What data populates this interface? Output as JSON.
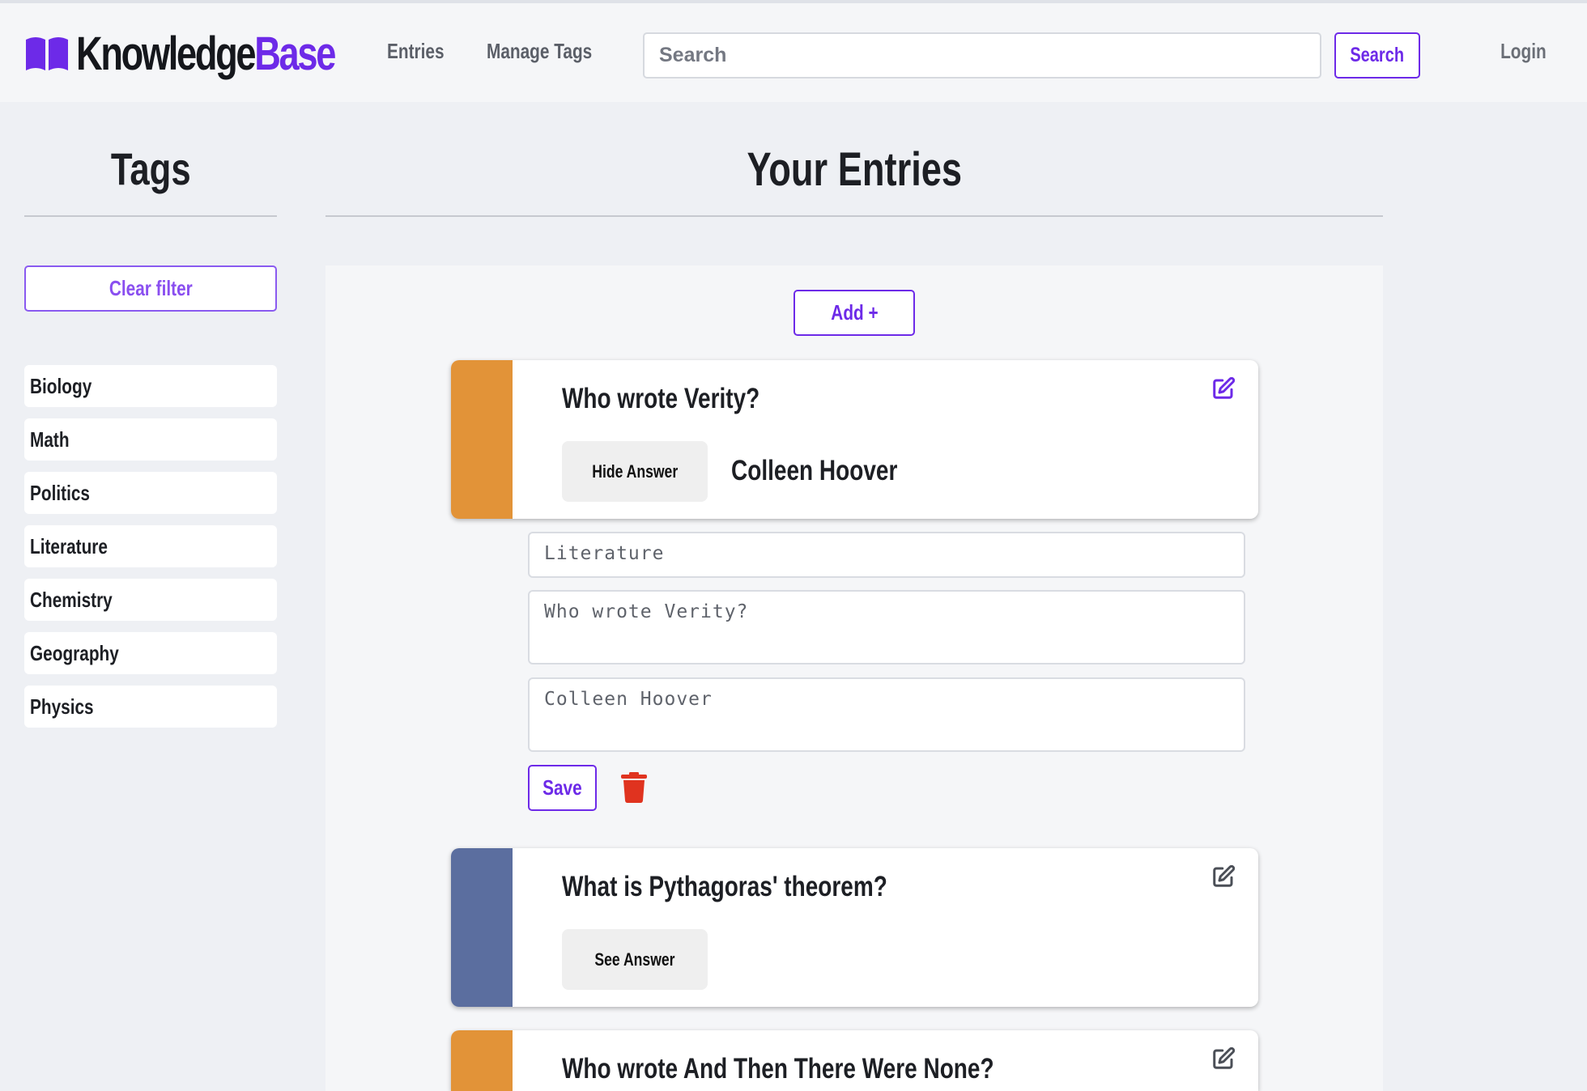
{
  "header": {
    "logo": {
      "part1": "Knowledge",
      "part2": "Base",
      "icon": "book-icon"
    },
    "nav": [
      {
        "label": "Entries"
      },
      {
        "label": "Manage Tags"
      }
    ],
    "search": {
      "placeholder": "Search",
      "value": "",
      "button_label": "Search"
    },
    "login_label": "Login"
  },
  "sidebar": {
    "title": "Tags",
    "clear_filter_label": "Clear filter",
    "tags": [
      {
        "label": "Biology"
      },
      {
        "label": "Math"
      },
      {
        "label": "Politics"
      },
      {
        "label": "Literature"
      },
      {
        "label": "Chemistry"
      },
      {
        "label": "Geography"
      },
      {
        "label": "Physics"
      }
    ]
  },
  "main": {
    "title": "Your Entries",
    "add_label": "Add +",
    "entries": [
      {
        "question": "Who wrote Verity?",
        "answer_button": "Hide Answer",
        "answer": "Colleen Hoover",
        "stripe_color": "#e29338",
        "edit_icon": "edit-icon",
        "edit_icon_color": "#6d2ae8"
      },
      {
        "question": "What is Pythagoras' theorem?",
        "answer_button": "See Answer",
        "stripe_color": "#5b6e9f",
        "edit_icon": "edit-icon",
        "edit_icon_color": "#4b4f57"
      },
      {
        "question": "Who wrote And Then There Were None?",
        "stripe_color": "#e29338",
        "edit_icon": "edit-icon",
        "edit_icon_color": "#4b4f57"
      }
    ],
    "edit_form": {
      "tag_value": "Literature",
      "question_value": "Who wrote Verity?",
      "answer_value": "Colleen Hoover",
      "save_label": "Save",
      "delete_icon": "trash-icon",
      "delete_color": "#e0331f"
    }
  },
  "colors": {
    "accent": "#6d2ae8",
    "background": "#eef0f4"
  }
}
